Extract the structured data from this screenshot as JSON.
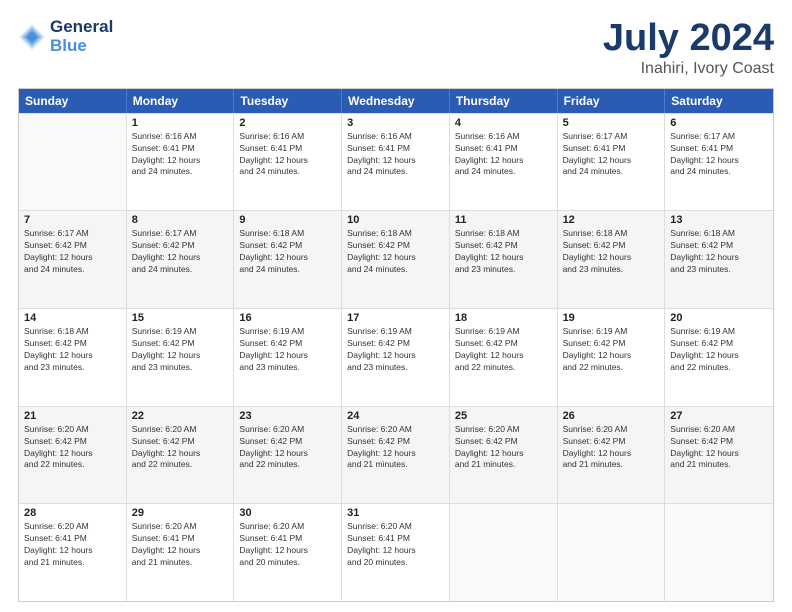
{
  "header": {
    "logo_line1": "General",
    "logo_line2": "Blue",
    "main_title": "July 2024",
    "subtitle": "Inahiri, Ivory Coast"
  },
  "days_of_week": [
    "Sunday",
    "Monday",
    "Tuesday",
    "Wednesday",
    "Thursday",
    "Friday",
    "Saturday"
  ],
  "weeks": [
    [
      {
        "day": "",
        "empty": true
      },
      {
        "day": "1",
        "sunrise": "6:16 AM",
        "sunset": "6:41 PM",
        "daylight": "12 hours and 24 minutes."
      },
      {
        "day": "2",
        "sunrise": "6:16 AM",
        "sunset": "6:41 PM",
        "daylight": "12 hours and 24 minutes."
      },
      {
        "day": "3",
        "sunrise": "6:16 AM",
        "sunset": "6:41 PM",
        "daylight": "12 hours and 24 minutes."
      },
      {
        "day": "4",
        "sunrise": "6:16 AM",
        "sunset": "6:41 PM",
        "daylight": "12 hours and 24 minutes."
      },
      {
        "day": "5",
        "sunrise": "6:17 AM",
        "sunset": "6:41 PM",
        "daylight": "12 hours and 24 minutes."
      },
      {
        "day": "6",
        "sunrise": "6:17 AM",
        "sunset": "6:41 PM",
        "daylight": "12 hours and 24 minutes."
      }
    ],
    [
      {
        "day": "7",
        "sunrise": "6:17 AM",
        "sunset": "6:42 PM",
        "daylight": "12 hours and 24 minutes."
      },
      {
        "day": "8",
        "sunrise": "6:17 AM",
        "sunset": "6:42 PM",
        "daylight": "12 hours and 24 minutes."
      },
      {
        "day": "9",
        "sunrise": "6:18 AM",
        "sunset": "6:42 PM",
        "daylight": "12 hours and 24 minutes."
      },
      {
        "day": "10",
        "sunrise": "6:18 AM",
        "sunset": "6:42 PM",
        "daylight": "12 hours and 24 minutes."
      },
      {
        "day": "11",
        "sunrise": "6:18 AM",
        "sunset": "6:42 PM",
        "daylight": "12 hours and 23 minutes."
      },
      {
        "day": "12",
        "sunrise": "6:18 AM",
        "sunset": "6:42 PM",
        "daylight": "12 hours and 23 minutes."
      },
      {
        "day": "13",
        "sunrise": "6:18 AM",
        "sunset": "6:42 PM",
        "daylight": "12 hours and 23 minutes."
      }
    ],
    [
      {
        "day": "14",
        "sunrise": "6:18 AM",
        "sunset": "6:42 PM",
        "daylight": "12 hours and 23 minutes."
      },
      {
        "day": "15",
        "sunrise": "6:19 AM",
        "sunset": "6:42 PM",
        "daylight": "12 hours and 23 minutes."
      },
      {
        "day": "16",
        "sunrise": "6:19 AM",
        "sunset": "6:42 PM",
        "daylight": "12 hours and 23 minutes."
      },
      {
        "day": "17",
        "sunrise": "6:19 AM",
        "sunset": "6:42 PM",
        "daylight": "12 hours and 23 minutes."
      },
      {
        "day": "18",
        "sunrise": "6:19 AM",
        "sunset": "6:42 PM",
        "daylight": "12 hours and 22 minutes."
      },
      {
        "day": "19",
        "sunrise": "6:19 AM",
        "sunset": "6:42 PM",
        "daylight": "12 hours and 22 minutes."
      },
      {
        "day": "20",
        "sunrise": "6:19 AM",
        "sunset": "6:42 PM",
        "daylight": "12 hours and 22 minutes."
      }
    ],
    [
      {
        "day": "21",
        "sunrise": "6:20 AM",
        "sunset": "6:42 PM",
        "daylight": "12 hours and 22 minutes."
      },
      {
        "day": "22",
        "sunrise": "6:20 AM",
        "sunset": "6:42 PM",
        "daylight": "12 hours and 22 minutes."
      },
      {
        "day": "23",
        "sunrise": "6:20 AM",
        "sunset": "6:42 PM",
        "daylight": "12 hours and 22 minutes."
      },
      {
        "day": "24",
        "sunrise": "6:20 AM",
        "sunset": "6:42 PM",
        "daylight": "12 hours and 21 minutes."
      },
      {
        "day": "25",
        "sunrise": "6:20 AM",
        "sunset": "6:42 PM",
        "daylight": "12 hours and 21 minutes."
      },
      {
        "day": "26",
        "sunrise": "6:20 AM",
        "sunset": "6:42 PM",
        "daylight": "12 hours and 21 minutes."
      },
      {
        "day": "27",
        "sunrise": "6:20 AM",
        "sunset": "6:42 PM",
        "daylight": "12 hours and 21 minutes."
      }
    ],
    [
      {
        "day": "28",
        "sunrise": "6:20 AM",
        "sunset": "6:41 PM",
        "daylight": "12 hours and 21 minutes."
      },
      {
        "day": "29",
        "sunrise": "6:20 AM",
        "sunset": "6:41 PM",
        "daylight": "12 hours and 21 minutes."
      },
      {
        "day": "30",
        "sunrise": "6:20 AM",
        "sunset": "6:41 PM",
        "daylight": "12 hours and 20 minutes."
      },
      {
        "day": "31",
        "sunrise": "6:20 AM",
        "sunset": "6:41 PM",
        "daylight": "12 hours and 20 minutes."
      },
      {
        "day": "",
        "empty": true
      },
      {
        "day": "",
        "empty": true
      },
      {
        "day": "",
        "empty": true
      }
    ]
  ]
}
